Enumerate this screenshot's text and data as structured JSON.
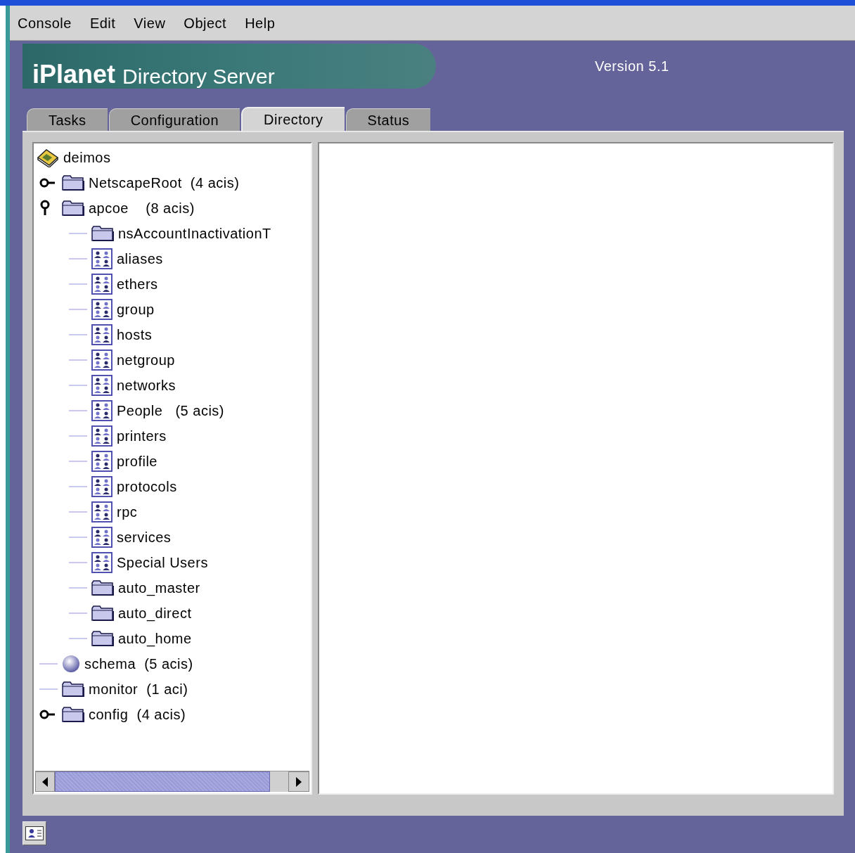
{
  "menu": [
    "Console",
    "Edit",
    "View",
    "Object",
    "Help"
  ],
  "banner": {
    "brand": "iPlanet",
    "product": "Directory Server",
    "version": "Version 5.1"
  },
  "tabs": [
    {
      "label": "Tasks",
      "selected": false
    },
    {
      "label": "Configuration",
      "selected": false
    },
    {
      "label": "Directory",
      "selected": true
    },
    {
      "label": "Status",
      "selected": false
    }
  ],
  "tree": {
    "label": "deimos",
    "kind": "server",
    "children": [
      {
        "label": "NetscapeRoot  (4 acis)",
        "kind": "folder",
        "expanded": false
      },
      {
        "label": "apcoe    (8 acis)",
        "kind": "folder",
        "expanded": true,
        "children": [
          {
            "label": "nsAccountInactivationT",
            "kind": "folder"
          },
          {
            "label": "aliases",
            "kind": "group"
          },
          {
            "label": "ethers",
            "kind": "group"
          },
          {
            "label": "group",
            "kind": "group"
          },
          {
            "label": "hosts",
            "kind": "group"
          },
          {
            "label": "netgroup",
            "kind": "group"
          },
          {
            "label": "networks",
            "kind": "group"
          },
          {
            "label": "People   (5 acis)",
            "kind": "group"
          },
          {
            "label": "printers",
            "kind": "group"
          },
          {
            "label": "profile",
            "kind": "group"
          },
          {
            "label": "protocols",
            "kind": "group"
          },
          {
            "label": "rpc",
            "kind": "group"
          },
          {
            "label": "services",
            "kind": "group"
          },
          {
            "label": "Special Users",
            "kind": "group"
          },
          {
            "label": "auto_master",
            "kind": "folder"
          },
          {
            "label": "auto_direct",
            "kind": "folder"
          },
          {
            "label": "auto_home",
            "kind": "folder"
          }
        ]
      },
      {
        "label": "schema  (5 acis)",
        "kind": "schema"
      },
      {
        "label": "monitor  (1 aci)",
        "kind": "folder"
      },
      {
        "label": "config  (4 acis)",
        "kind": "folder",
        "expanded": false
      }
    ]
  }
}
